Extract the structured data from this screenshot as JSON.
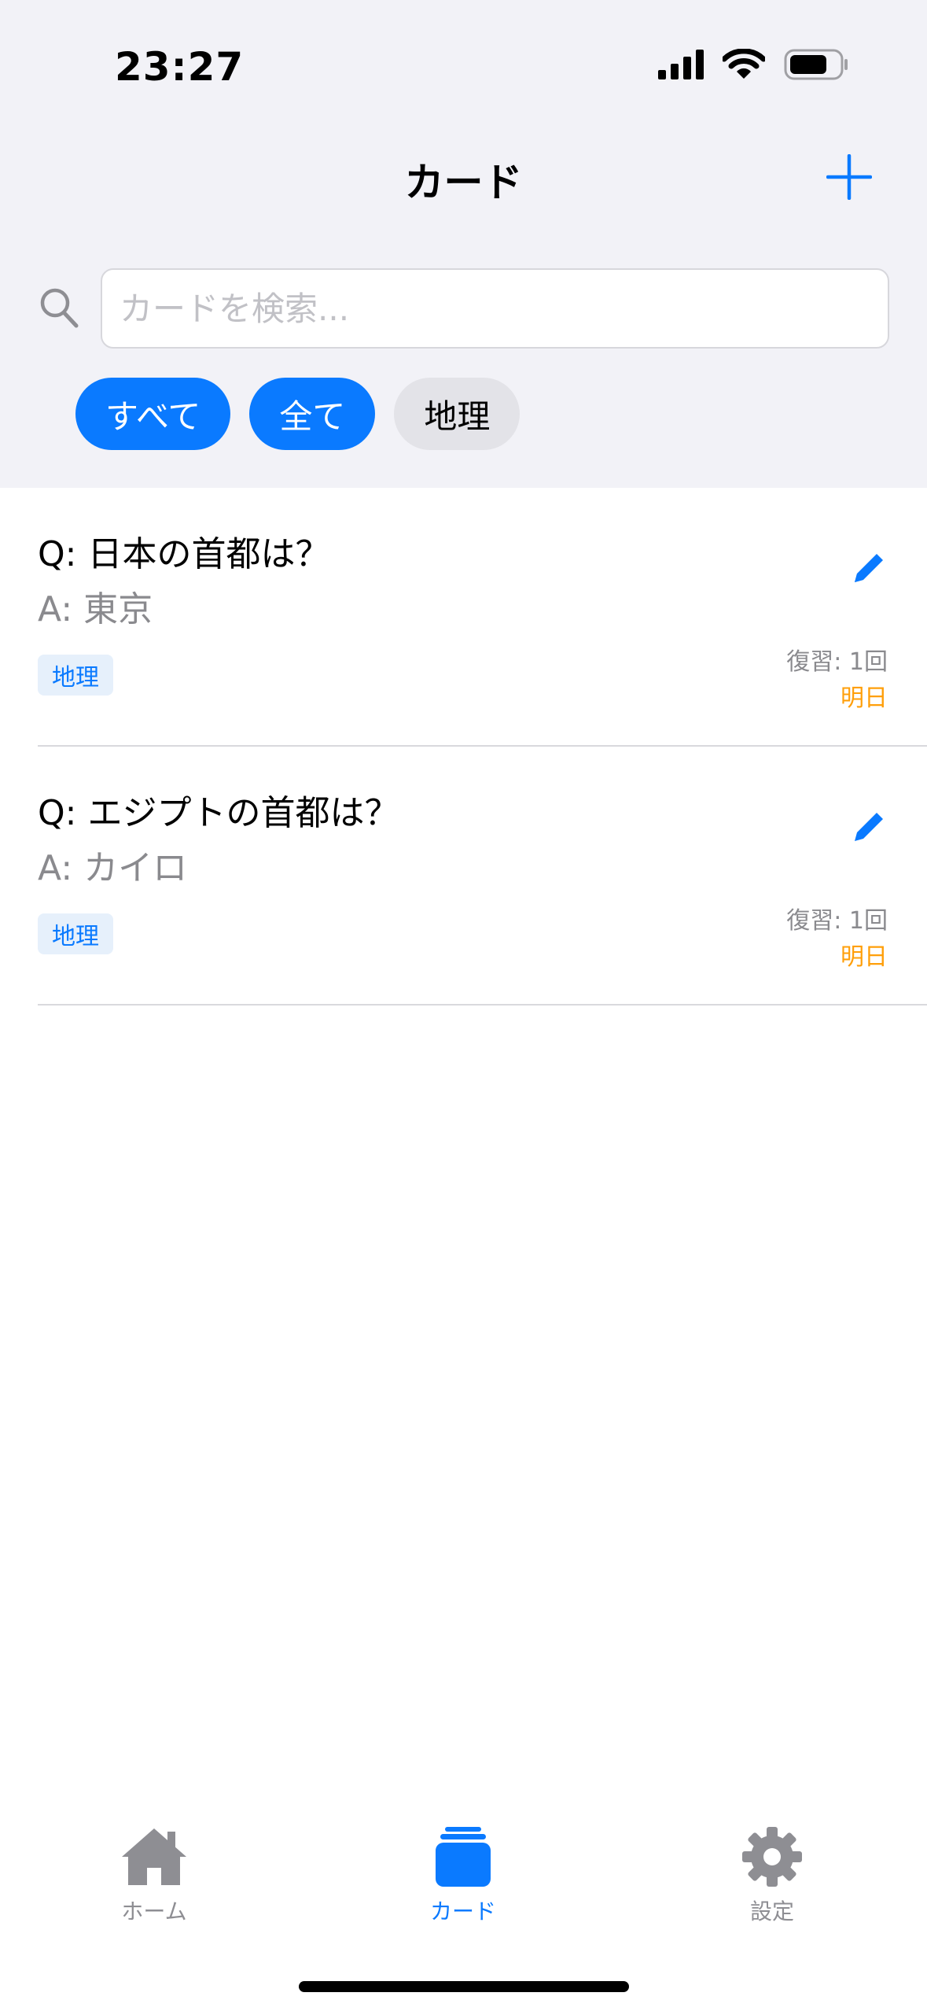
{
  "status_bar": {
    "time": "23:27"
  },
  "nav": {
    "title": "カード"
  },
  "search": {
    "placeholder": "カードを検索..."
  },
  "filters": [
    {
      "label": "すべて",
      "active": true
    },
    {
      "label": "全て",
      "active": true
    },
    {
      "label": "地理",
      "active": false
    }
  ],
  "cards": [
    {
      "question": "Q: 日本の首都は？",
      "answer": "A: 東京",
      "tag": "地理",
      "review": "復習: 1回",
      "due": "明日"
    },
    {
      "question": "Q: エジプトの首都は？",
      "answer": "A: カイロ",
      "tag": "地理",
      "review": "復習: 1回",
      "due": "明日"
    }
  ],
  "tab_bar": {
    "home": "ホーム",
    "cards": "カード",
    "settings": "設定"
  },
  "icons": {
    "add": "plus-icon",
    "search": "magnifier-icon",
    "edit": "pencil-icon",
    "home": "house-icon",
    "cards": "stack-icon",
    "settings": "gear-icon"
  },
  "colors": {
    "accent": "#0a7aff",
    "due": "#ff9f0a",
    "secondary_text": "#8a8a8e",
    "header_bg": "#f2f2f7"
  }
}
